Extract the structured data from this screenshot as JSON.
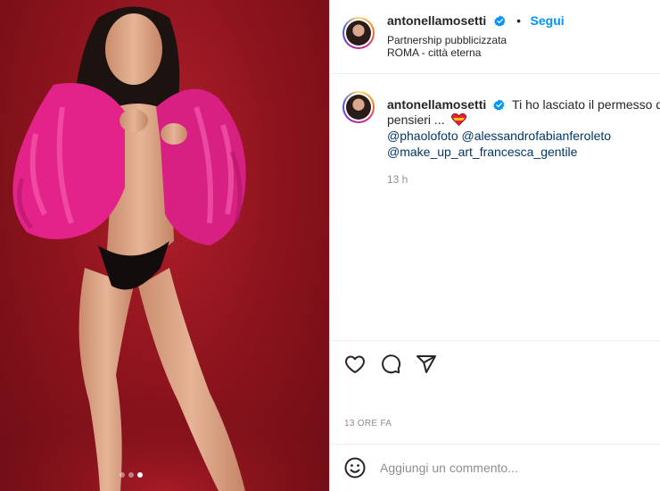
{
  "post": {
    "username": "antonellamosetti",
    "verified": true,
    "follow_label": "Segui",
    "separator": "•",
    "sponsor_label": "Partnership pubblicizzata",
    "location": "ROMA - città eterna"
  },
  "caption": {
    "username": "antonellamosetti",
    "text_line1": "Ti ho lasciato il permesso di S",
    "text_line2": "pensieri ...",
    "emoji": "❤️",
    "mentions_line1": [
      "@phaolofoto",
      "@alessandrofabianferoleto"
    ],
    "mentions_line2": [
      "@make_up_art_francesca_gentile"
    ],
    "relative_time": "13 h"
  },
  "actions": {
    "like_icon": "heart-icon",
    "comment_icon": "comment-icon",
    "share_icon": "share-icon"
  },
  "timestamp": "13 ORE FA",
  "comment_box": {
    "emoji_icon": "smiley-icon",
    "placeholder": "Aggiungi un commento..."
  },
  "carousel": {
    "count": 3,
    "active_index": 2
  },
  "colors": {
    "accent": "#0095f6",
    "mention": "#00376b",
    "muted": "#8e8e8e",
    "background_red": "#9a1720",
    "fur_pink": "#e3238a"
  }
}
